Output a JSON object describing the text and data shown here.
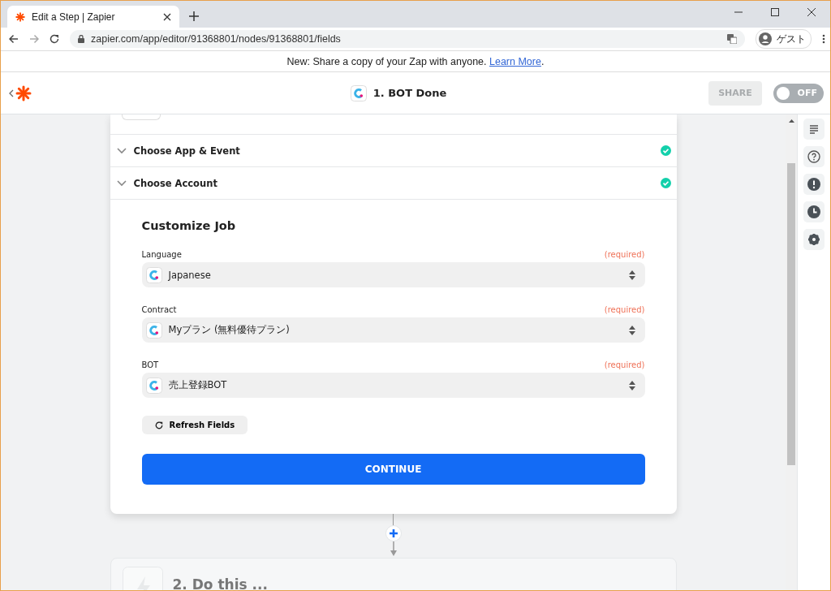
{
  "browser": {
    "tab_title": "Edit a Step | Zapier",
    "url": "zapier.com/app/editor/91368801/nodes/91368801/fields",
    "profile_label": "ゲスト"
  },
  "banner": {
    "text": "New: Share a copy of your Zap with anyone.",
    "link": "Learn More",
    "suffix": "."
  },
  "header": {
    "step_title": "1. BOT Done",
    "share_button": "SHARE",
    "toggle": {
      "label": "OFF",
      "on": false
    }
  },
  "sections": [
    {
      "title": "Choose App & Event",
      "complete": true
    },
    {
      "title": "Choose Account",
      "complete": true
    }
  ],
  "form": {
    "heading": "Customize Job",
    "fields": [
      {
        "label": "Language",
        "required_note": "(required)",
        "value": "Japanese"
      },
      {
        "label": "Contract",
        "required_note": "(required)",
        "value": "Myプラン (無料優待プラン)"
      },
      {
        "label": "BOT",
        "required_note": "(required)",
        "value": "売上登録BOT"
      }
    ],
    "refresh_button": "Refresh Fields",
    "continue_button": "CONTINUE"
  },
  "next_step": {
    "title": "2. Do this ..."
  }
}
